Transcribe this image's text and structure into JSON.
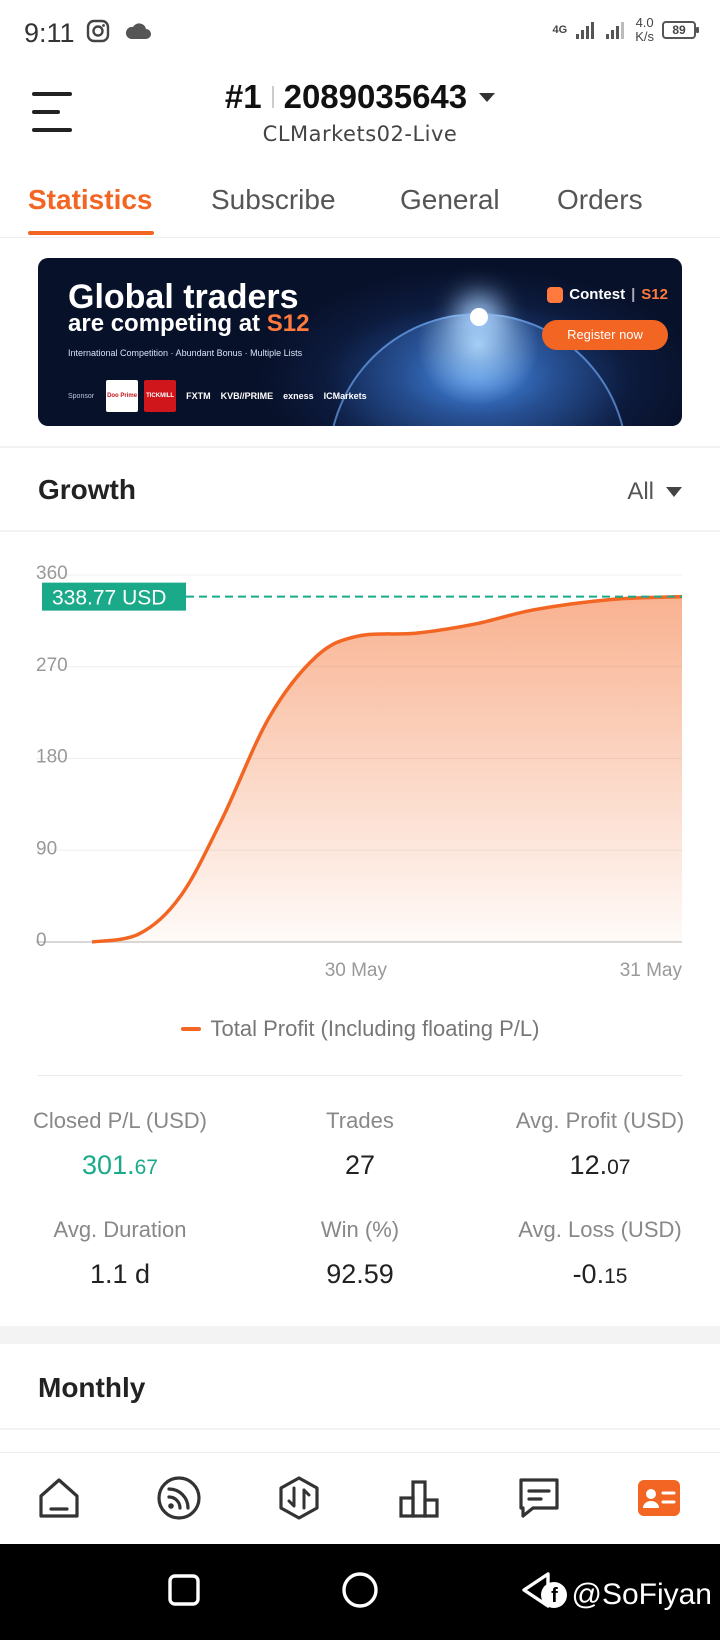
{
  "status": {
    "time": "9:11",
    "network": "4G",
    "speed_value": "4.0",
    "speed_unit": "K/s",
    "battery": "89"
  },
  "header": {
    "rank": "#1",
    "account_id": "2089035643",
    "server": "CLMarkets02-Live"
  },
  "tabs": [
    {
      "label": "Statistics",
      "active": true
    },
    {
      "label": "Subscribe",
      "active": false
    },
    {
      "label": "General",
      "active": false
    },
    {
      "label": "Orders",
      "active": false
    }
  ],
  "banner": {
    "headline": "Global traders",
    "subheadline_pre": "are competing at ",
    "subheadline_accent": "S12",
    "tagline": "International Competition · Abundant Bonus · Multiple Lists",
    "sponsor_label": "Sponsor",
    "sponsors": [
      "Doo Prime",
      "TICKMILL",
      "FXTM",
      "KVB//PRIME",
      "exness",
      "ICMarkets"
    ],
    "contest_label": "Contest",
    "contest_season": "S12",
    "register_label": "Register now"
  },
  "growth": {
    "title": "Growth",
    "filter": "All",
    "current_label": "338.77 USD",
    "legend": "Total Profit (Including floating P/L)"
  },
  "chart_data": {
    "type": "area",
    "series": [
      {
        "name": "Total Profit (Including floating P/L)",
        "color": "#f26522",
        "points": [
          {
            "x": 0.0,
            "y": 0
          },
          {
            "x": 0.08,
            "y": 8
          },
          {
            "x": 0.15,
            "y": 45
          },
          {
            "x": 0.22,
            "y": 120
          },
          {
            "x": 0.3,
            "y": 220
          },
          {
            "x": 0.38,
            "y": 280
          },
          {
            "x": 0.45,
            "y": 300
          },
          {
            "x": 0.55,
            "y": 303
          },
          {
            "x": 0.65,
            "y": 312
          },
          {
            "x": 0.75,
            "y": 326
          },
          {
            "x": 0.88,
            "y": 336
          },
          {
            "x": 1.0,
            "y": 338.77
          }
        ]
      }
    ],
    "y_ticks": [
      "360",
      "270",
      "180",
      "90",
      "0"
    ],
    "y_tick_values": [
      360,
      270,
      180,
      90,
      0
    ],
    "ylim": [
      0,
      360
    ],
    "x_ticks": [
      {
        "label": "30 May",
        "x": 0.5
      },
      {
        "label": "31 May",
        "x": 1.0
      }
    ],
    "reference_value": 338.77,
    "grid": true,
    "legend_position": "bottom"
  },
  "stats": [
    {
      "label": "Closed P/L (USD)",
      "int": "301.",
      "dec": "67",
      "green": true
    },
    {
      "label": "Trades",
      "int": "27",
      "dec": "",
      "green": false
    },
    {
      "label": "Avg. Profit (USD)",
      "int": "12.",
      "dec": "07",
      "green": false
    },
    {
      "label": "Avg. Duration",
      "int": "1.1 d",
      "dec": "",
      "green": false
    },
    {
      "label": "Win (%)",
      "int": "92.59",
      "dec": "",
      "green": false
    },
    {
      "label": "Avg. Loss (USD)",
      "int": "-0.",
      "dec": "15",
      "green": false
    }
  ],
  "monthly": {
    "title": "Monthly"
  },
  "nav_icons": [
    "home-icon",
    "feed-icon",
    "trade-icon",
    "ranking-icon",
    "messages-icon",
    "profile-icon"
  ],
  "colors": {
    "accent": "#f26522",
    "positive": "#1aaa8a"
  },
  "watermark": "@SoFiyan"
}
